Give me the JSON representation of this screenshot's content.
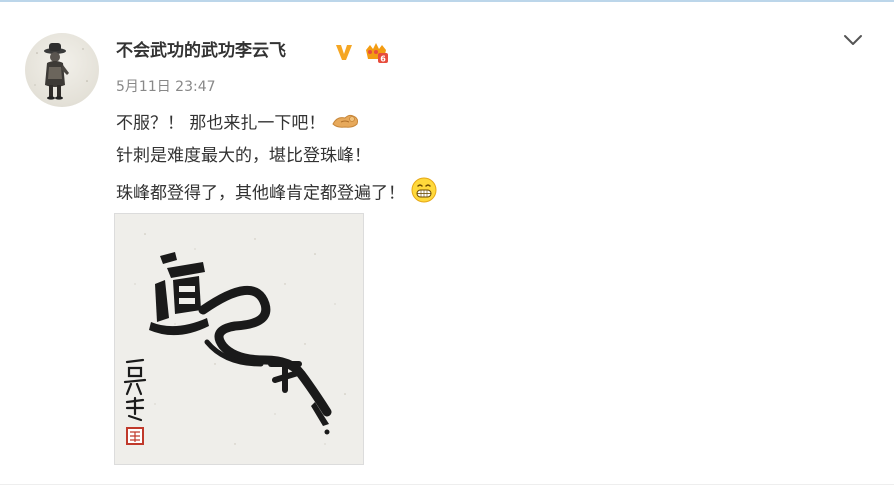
{
  "post": {
    "author": {
      "name": "不会武功的武功李云飞",
      "avatar_icon": "avatar-photo",
      "verified_icon": "verified-v-icon",
      "vip_icon": "vip-crown-icon"
    },
    "timestamp": "5月11日 23:47",
    "lines": [
      {
        "text": "不服？！ 那也来扎一下吧！",
        "emoji": "flexed-arm-emoji"
      },
      {
        "text": "针刺是难度最大的，堪比登珠峰！"
      },
      {
        "text": "珠峰都登得了，其他峰肯定都登遍了！",
        "emoji": "grinning-face-emoji"
      }
    ],
    "image": {
      "description_icon": "calligraphy-artwork"
    },
    "menu_icon": "chevron-down-icon"
  },
  "colors": {
    "text": "#333333",
    "muted": "#888888",
    "verified": "#f5a623",
    "accent_rule": "#bcd6ea",
    "ink": "#1a1a1a",
    "seal": "#c0392b"
  }
}
